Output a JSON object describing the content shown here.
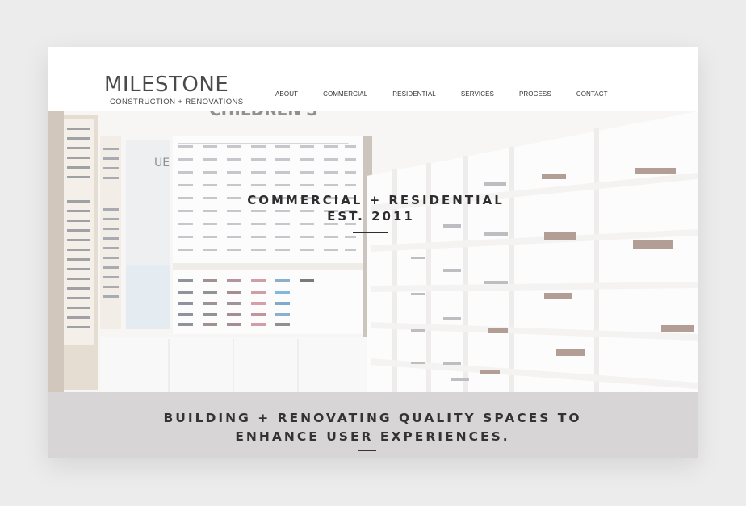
{
  "header": {
    "logo_word": "MILESTONE",
    "logo_sub": "CONSTRUCTION + RENOVATIONS",
    "nav": [
      "ABOUT",
      "COMMERCIAL",
      "RESIDENTIAL",
      "SERVICES",
      "PROCESS",
      "CONTACT"
    ]
  },
  "hero": {
    "line1": "COMMERCIAL + RESIDENTIAL",
    "line2": "EST. 2011",
    "sign_text": "CHILDREN'S",
    "mirror_text": "UE"
  },
  "band": {
    "line1": "BUILDING + RENOVATING QUALITY SPACES TO",
    "line2": "ENHANCE USER EXPERIENCES."
  },
  "colors": {
    "page_bg": "#ececed",
    "text_dark": "#2e2e30",
    "band_bg": "#d7d5d5",
    "shelf": "#ffffff"
  }
}
